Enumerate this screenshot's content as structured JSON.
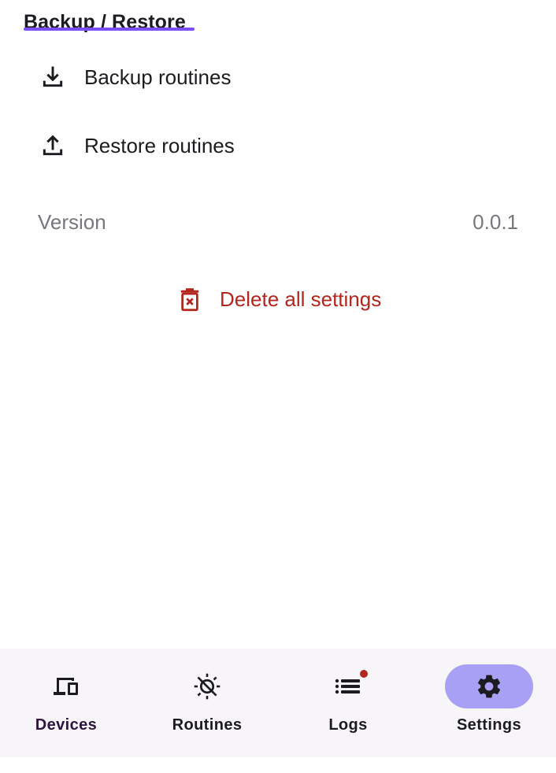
{
  "section": {
    "title": "Backup / Restore",
    "accent_color": "#7c4dff"
  },
  "items": {
    "backup": {
      "label": "Backup routines",
      "icon": "download-icon"
    },
    "restore": {
      "label": "Restore routines",
      "icon": "upload-icon"
    }
  },
  "version": {
    "label": "Version",
    "value": "0.0.1"
  },
  "delete": {
    "label": "Delete all settings",
    "icon": "trash-icon",
    "color": "#b3261e"
  },
  "nav": {
    "devices": {
      "label": "Devices",
      "icon": "devices-icon"
    },
    "routines": {
      "label": "Routines",
      "icon": "routines-icon"
    },
    "logs": {
      "label": "Logs",
      "icon": "list-icon",
      "has_badge": true
    },
    "settings": {
      "label": "Settings",
      "icon": "gear-icon",
      "active": true
    },
    "active_indicator_color": "#a8a0f5"
  }
}
